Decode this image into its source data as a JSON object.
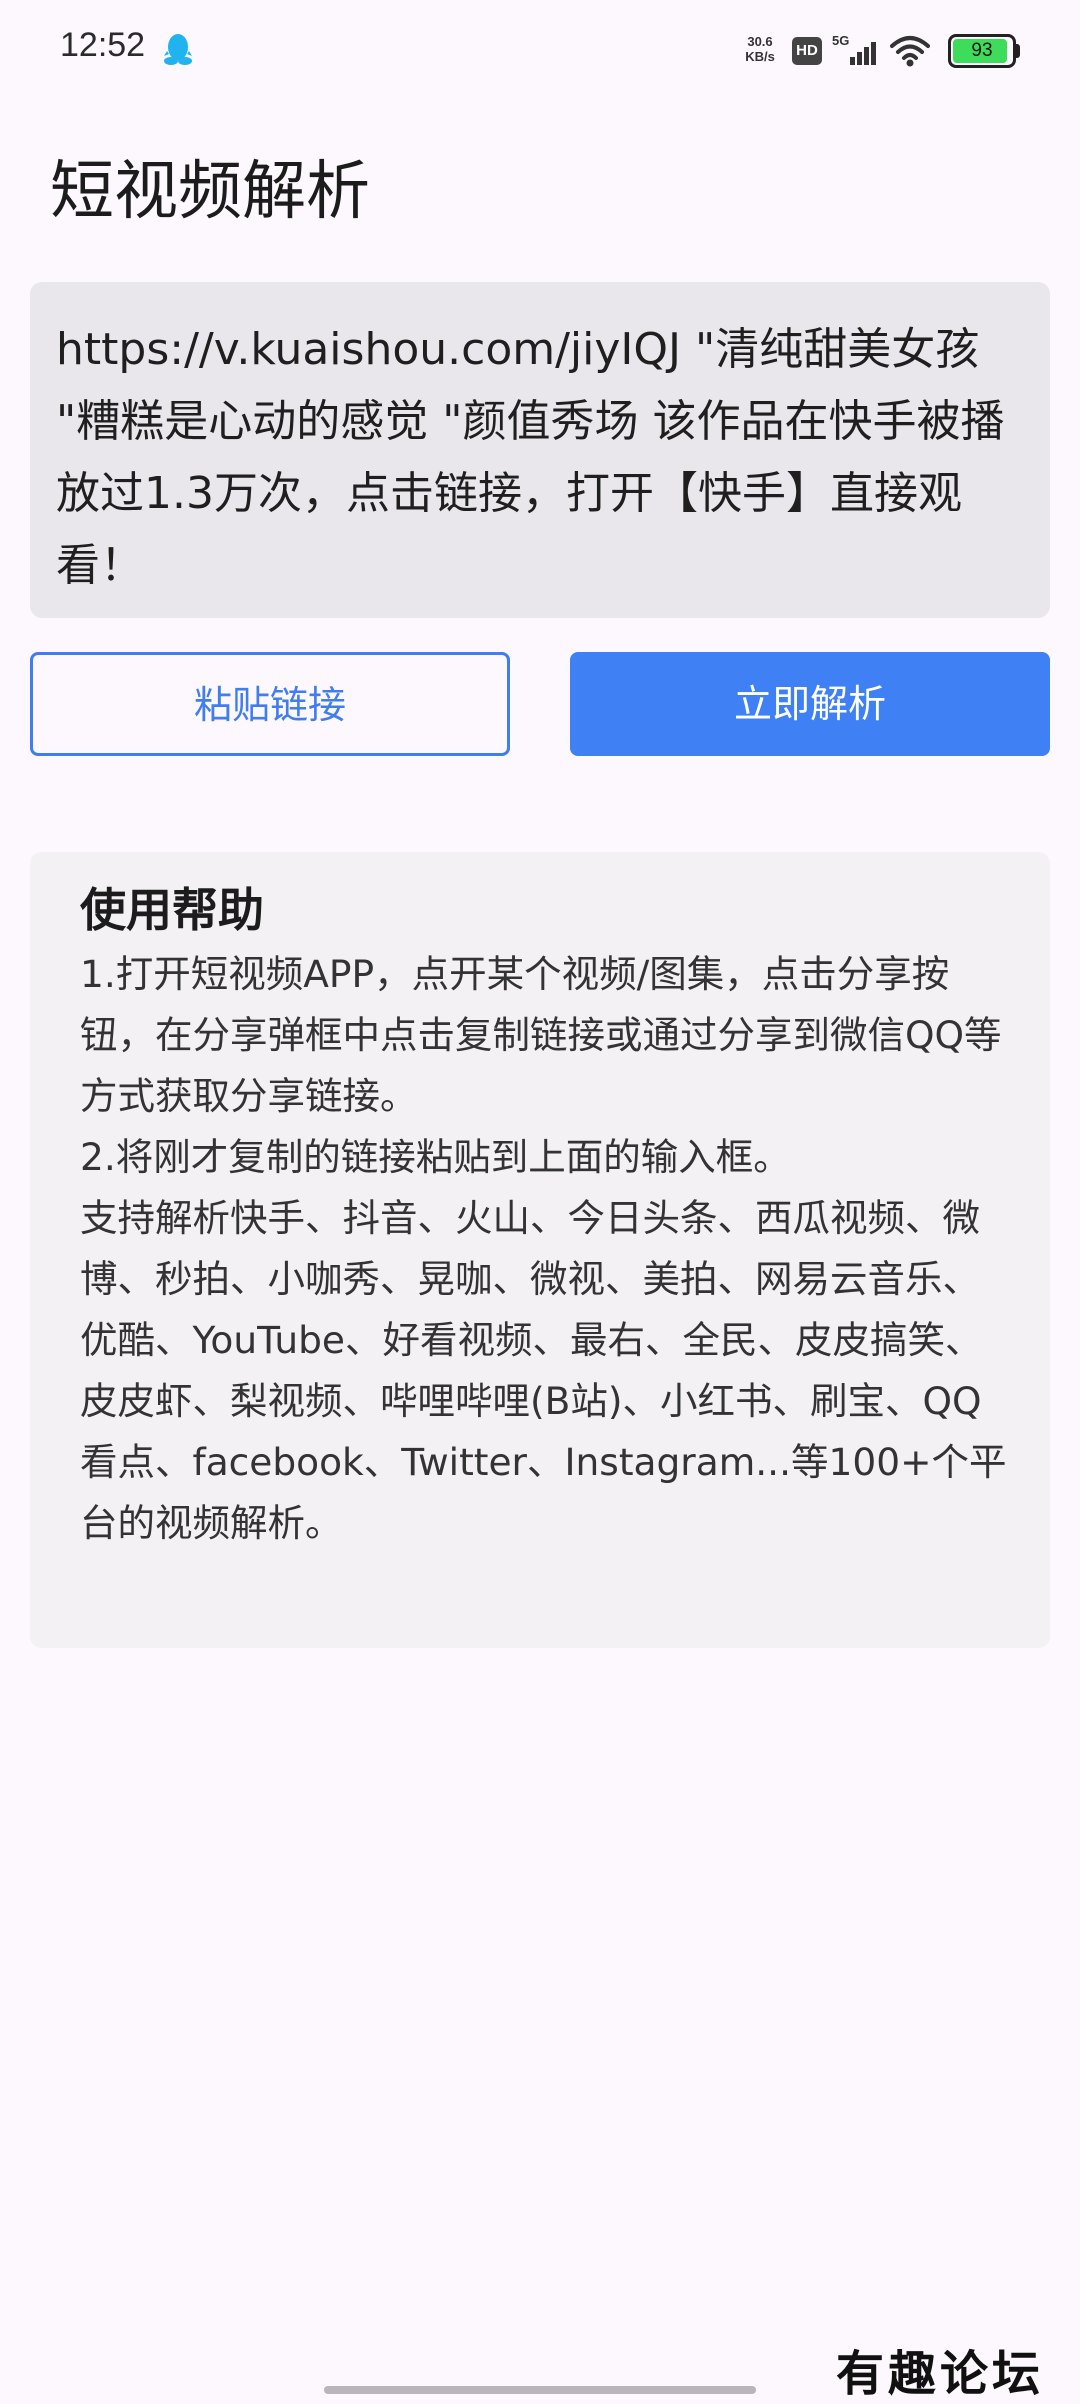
{
  "status_bar": {
    "time": "12:52",
    "net_speed_value": "30.6",
    "net_speed_unit": "KB/s",
    "hd_label": "HD",
    "network_label": "5G",
    "battery_level": "93",
    "battery_fraction": 0.93,
    "notification_icon": "qq-penguin-icon"
  },
  "page": {
    "title": "短视频解析"
  },
  "link_input": {
    "value": "https://v.kuaishou.com/jiyIQJ \"清纯甜美女孩 \"糟糕是心动的感觉 \"颜值秀场 该作品在快手被播放过1.3万次，点击链接，打开【快手】直接观看！"
  },
  "buttons": {
    "paste_label": "粘贴链接",
    "parse_label": "立即解析"
  },
  "help": {
    "title": "使用帮助",
    "steps": [
      "1.打开短视频APP，点开某个视频/图集，点击分享按钮，在分享弹框中点击复制链接或通过分享到微信QQ等方式获取分享链接。",
      "2.将刚才复制的链接粘贴到上面的输入框。",
      "支持解析快手、抖音、火山、今日头条、西瓜视频、微博、秒拍、小咖秀、晃咖、微视、美拍、网易云音乐、优酷、YouTube、好看视频、最右、全民、皮皮搞笑、皮皮虾、梨视频、哔哩哔哩(B站)、小红书、刷宝、QQ看点、facebook、Twitter、Instagram...等100+个平台的视频解析。"
    ]
  },
  "watermark": {
    "text": "有趣论坛"
  },
  "colors": {
    "accent": "#3f81f4",
    "background": "#fcf8fd",
    "input_bg": "#e9e7ec",
    "card_bg": "#f3f1f4",
    "battery": "#3ddc5b"
  }
}
